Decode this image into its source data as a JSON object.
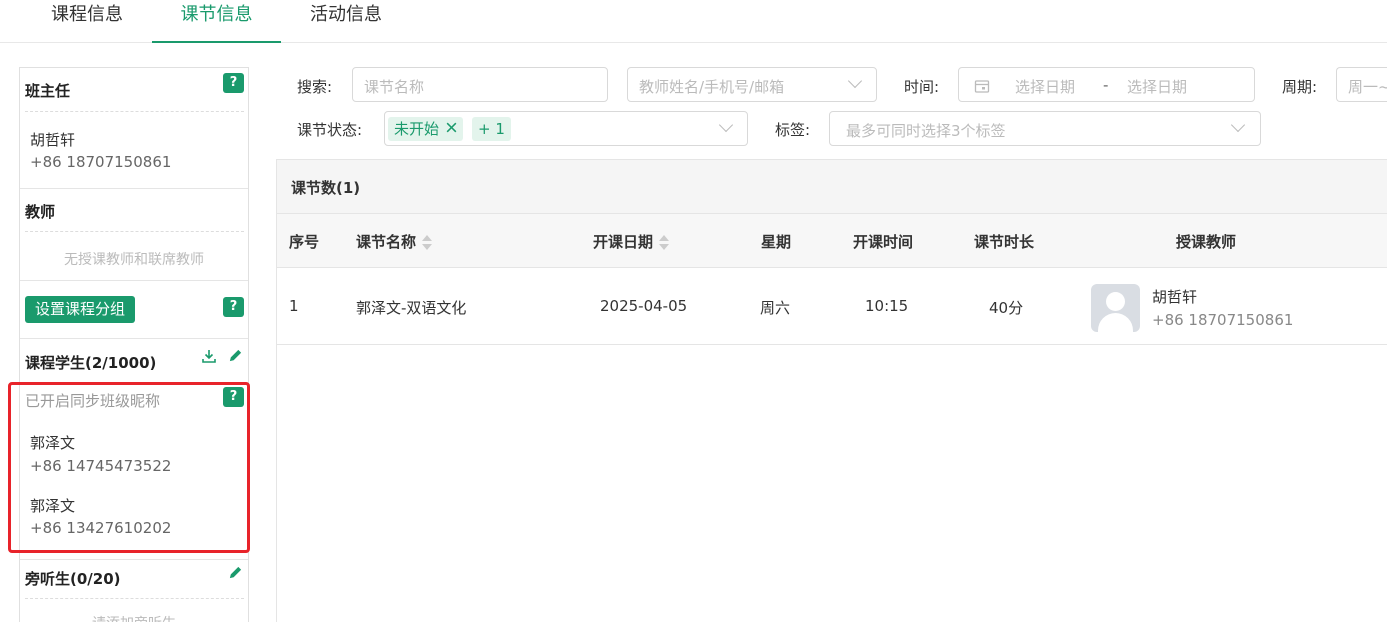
{
  "tabs": [
    {
      "label": "课程信息"
    },
    {
      "label": "课节信息"
    },
    {
      "label": "活动信息"
    }
  ],
  "left": {
    "head_teacher": {
      "title": "班主任",
      "name": "胡哲轩",
      "phone": "+86 18707150861"
    },
    "teachers": {
      "title": "教师",
      "empty": "无授课教师和联席教师"
    },
    "group_button": "设置课程分组",
    "students": {
      "title": "课程学生(2/1000)",
      "sync_note": "已开启同步班级昵称",
      "items": [
        {
          "name": "郭泽文",
          "phone": "+86 14745473522"
        },
        {
          "name": "郭泽文",
          "phone": "+86 13427610202"
        }
      ]
    },
    "auditors": {
      "title": "旁听生(0/20)",
      "empty": "请添加旁听生"
    },
    "help_label": "?"
  },
  "filters": {
    "search_label": "搜索:",
    "search_placeholder": "课节名称",
    "teacher_placeholder": "教师姓名/手机号/邮箱",
    "time_label": "时间:",
    "date_start": "选择日期",
    "date_sep": "-",
    "date_end": "选择日期",
    "period_label": "周期:",
    "period_placeholder": "周一~",
    "status_label": "课节状态:",
    "status_chip": "未开始",
    "status_more": "+ 1",
    "tag_label": "标签:",
    "tag_placeholder": "最多可同时选择3个标签"
  },
  "table": {
    "count_label": "课节数(1)",
    "headers": [
      "序号",
      "课节名称",
      "开课日期",
      "星期",
      "开课时间",
      "课节时长",
      "授课教师"
    ],
    "rows": [
      {
        "index": "1",
        "name": "郭泽文-双语文化",
        "date": "2025-04-05",
        "weekday": "周六",
        "time": "10:15",
        "duration": "40分",
        "teacher_name": "胡哲轩",
        "teacher_phone": "+86 18707150861"
      }
    ]
  },
  "colors": {
    "accent": "#1a9a6c",
    "highlight": "#e8232a"
  }
}
